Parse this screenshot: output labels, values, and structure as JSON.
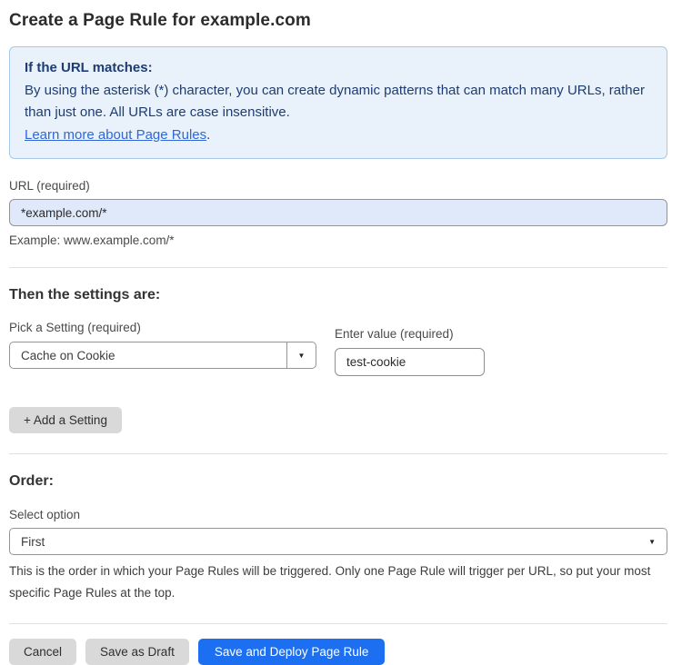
{
  "page": {
    "title": "Create a Page Rule for example.com"
  },
  "info_box": {
    "heading": "If the URL matches:",
    "body": "By using the asterisk (*) character, you can create dynamic patterns that can match many URLs, rather than just one. All URLs are case insensitive.",
    "link_label": "Learn more about Page Rules",
    "link_suffix": "."
  },
  "url_field": {
    "label": "URL (required)",
    "value": "*example.com/*",
    "example": "Example: www.example.com/*"
  },
  "settings_section": {
    "heading": "Then the settings are:",
    "setting_picker": {
      "label": "Pick a Setting (required)",
      "selected": "Cache on Cookie",
      "dropdown_icon": "▼"
    },
    "value_field": {
      "label": "Enter value (required)",
      "value": "test-cookie"
    },
    "add_setting_label": "+ Add a Setting"
  },
  "order_section": {
    "heading": "Order:",
    "select_label": "Select option",
    "selected_option": "First",
    "dropdown_icon": "▼",
    "help_text": "This is the order in which your Page Rules will be triggered. Only one Page Rule will trigger per URL, so put your most specific Page Rules at the top."
  },
  "actions": {
    "cancel": "Cancel",
    "save_draft": "Save as Draft",
    "save_deploy": "Save and Deploy Page Rule"
  },
  "colors": {
    "info_bg": "#e9f2fb",
    "info_border": "#a9c9ea",
    "info_text": "#1e3c71",
    "link": "#3066d9",
    "url_input_bg": "#dfe9fa",
    "primary_button": "#1d6ff2",
    "secondary_button": "#d9d9d9"
  }
}
